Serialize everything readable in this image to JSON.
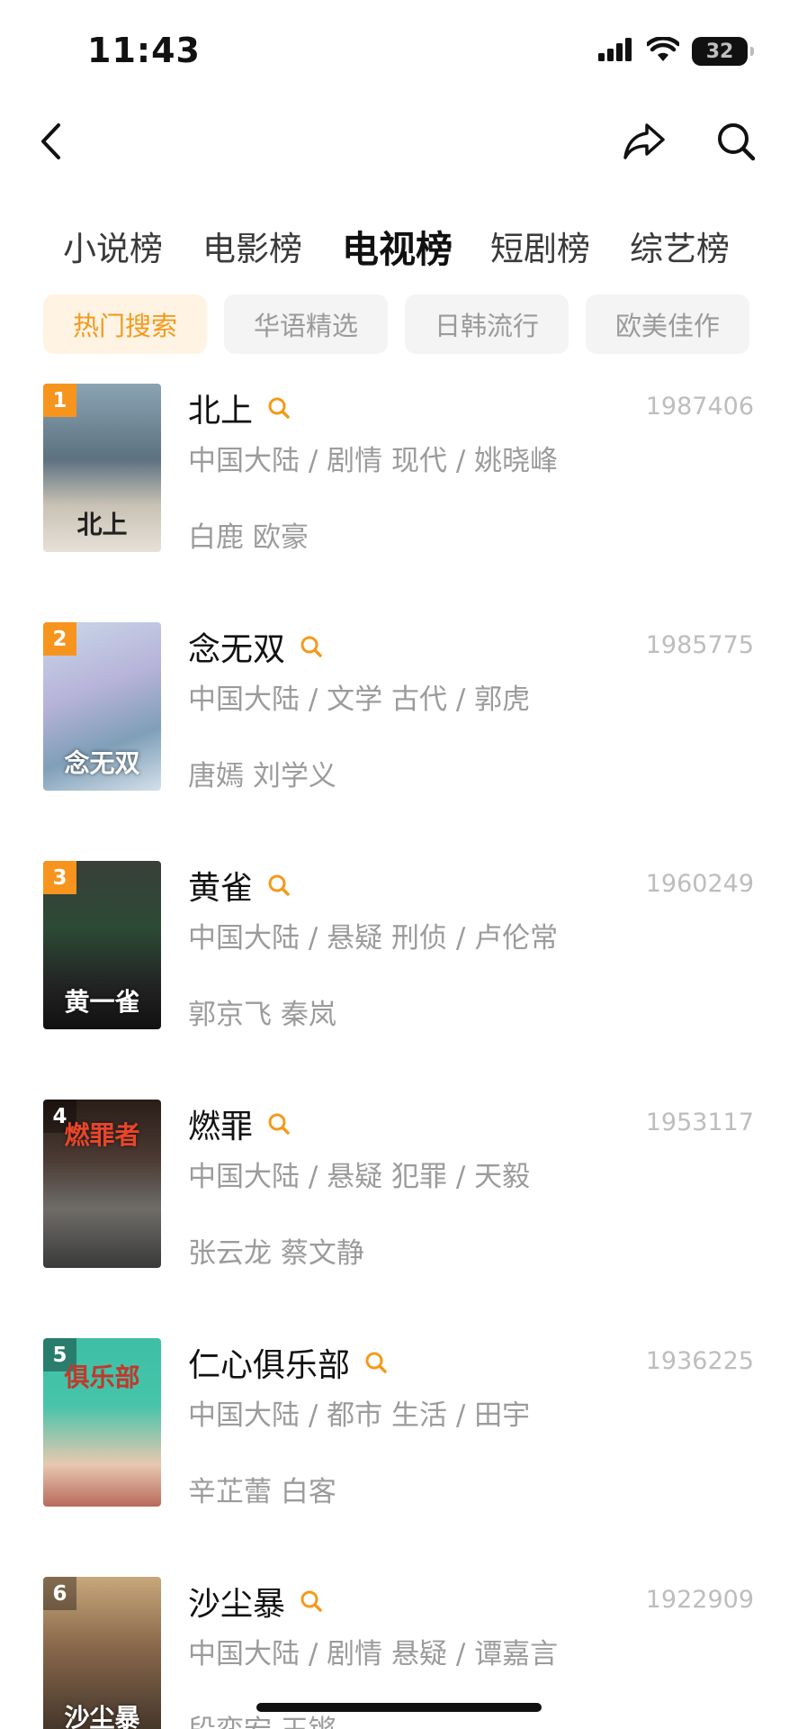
{
  "status_bar": {
    "time": "11:43",
    "battery": "32",
    "icons": [
      "cellular-signal-icon",
      "wifi-icon",
      "battery-icon"
    ]
  },
  "nav": {
    "icons": [
      "chevron-left-icon",
      "share-arrow-icon",
      "search-icon"
    ]
  },
  "category_tabs": [
    {
      "label": "小说榜",
      "active": false
    },
    {
      "label": "电影榜",
      "active": false
    },
    {
      "label": "电视榜",
      "active": true
    },
    {
      "label": "短剧榜",
      "active": false
    },
    {
      "label": "综艺榜",
      "active": false
    }
  ],
  "sub_tabs": [
    {
      "label": "热门搜索",
      "active": true
    },
    {
      "label": "华语精选",
      "active": false
    },
    {
      "label": "日韩流行",
      "active": false
    },
    {
      "label": "欧美佳作",
      "active": false
    }
  ],
  "colors": {
    "accent": "#f7941d",
    "accent_text": "#f39a1b",
    "muted_text": "#9b9b9b",
    "count_text": "#bdbdbd"
  },
  "items": [
    {
      "rank": "1",
      "title": "北上",
      "count": "1987406",
      "meta": "中国大陆 / 剧情 现代 / 姚晓峰",
      "cast": "白鹿 欧豪",
      "poster_text": "北上"
    },
    {
      "rank": "2",
      "title": "念无双",
      "count": "1985775",
      "meta": "中国大陆 / 文学 古代 / 郭虎",
      "cast": "唐嫣 刘学义",
      "poster_text": "念无双"
    },
    {
      "rank": "3",
      "title": "黄雀",
      "count": "1960249",
      "meta": "中国大陆 / 悬疑 刑侦 / 卢伦常",
      "cast": "郭京飞 秦岚",
      "poster_text": "黄一雀"
    },
    {
      "rank": "4",
      "title": "燃罪",
      "count": "1953117",
      "meta": "中国大陆 / 悬疑 犯罪 / 天毅",
      "cast": "张云龙 蔡文静",
      "poster_text": "燃罪者"
    },
    {
      "rank": "5",
      "title": "仁心俱乐部",
      "count": "1936225",
      "meta": "中国大陆 / 都市 生活 / 田宇",
      "cast": "辛芷蕾 白客",
      "poster_text": "俱乐部"
    },
    {
      "rank": "6",
      "title": "沙尘暴",
      "count": "1922909",
      "meta": "中国大陆 / 剧情 悬疑 / 谭嘉言",
      "cast": "段奕宏 王锵",
      "poster_text": "沙尘暴"
    }
  ]
}
